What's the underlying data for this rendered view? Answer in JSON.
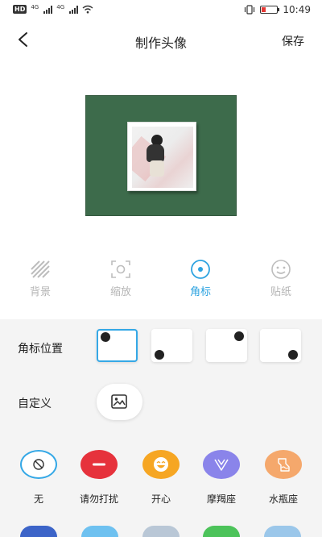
{
  "status_bar": {
    "network_label_1": "4G",
    "network_label_2": "4G",
    "time": "10:49",
    "battery_level": 0.25
  },
  "header": {
    "title": "制作头像",
    "save_label": "保存"
  },
  "colors": {
    "canvas_background": "#3d6b4b",
    "accent": "#2ea3e0",
    "tab_inactive": "#b5b5b5",
    "panel_background": "#f4f4f4"
  },
  "tabs": [
    {
      "label": "背景",
      "icon": "stripes-icon",
      "active": false
    },
    {
      "label": "缩放",
      "icon": "scale-frame-icon",
      "active": false
    },
    {
      "label": "角标",
      "icon": "badge-dot-icon",
      "active": true
    },
    {
      "label": "贴纸",
      "icon": "smiley-icon",
      "active": false
    }
  ],
  "corner_position": {
    "label": "角标位置",
    "options": [
      "top-left",
      "bottom-left",
      "top-right",
      "bottom-right"
    ],
    "selected": "top-left"
  },
  "custom": {
    "label": "自定义",
    "icon": "image-icon"
  },
  "badges": [
    {
      "label": "无",
      "icon": "none-icon",
      "color": "#ffffff"
    },
    {
      "label": "请勿打扰",
      "icon": "minus-icon",
      "color": "#e6323c"
    },
    {
      "label": "开心",
      "icon": "laugh-icon",
      "color": "#f6a623"
    },
    {
      "label": "摩羯座",
      "icon": "capricorn-icon",
      "color": "#8a84ea"
    },
    {
      "label": "水瓶座",
      "icon": "aquarius-icon",
      "color": "#f5a86c"
    }
  ]
}
